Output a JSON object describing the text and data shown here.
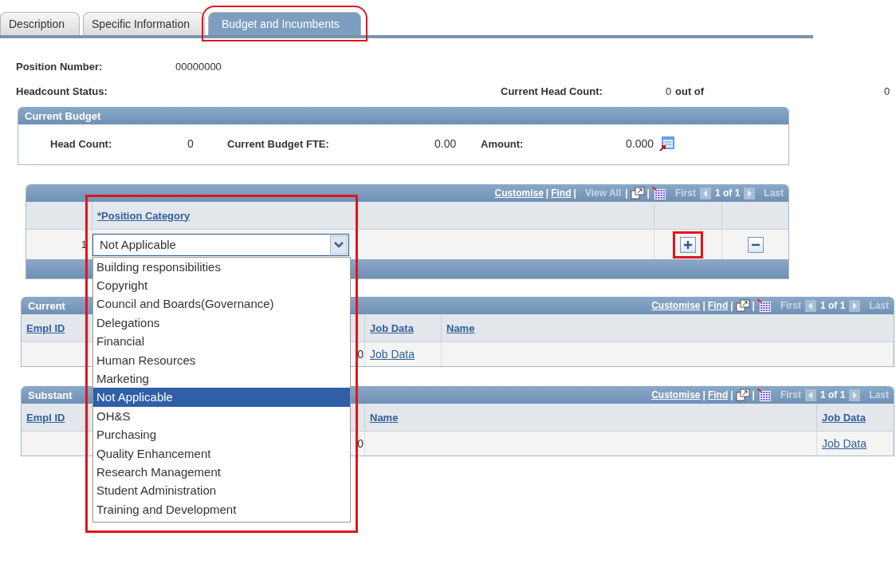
{
  "tabs": [
    {
      "label": "Description",
      "selected": false,
      "highlight": false
    },
    {
      "label": "Specific Information",
      "selected": false,
      "highlight": false
    },
    {
      "label": "Budget and Incumbents",
      "selected": true,
      "highlight": true
    }
  ],
  "position_number": {
    "label": "Position Number:",
    "value": "00000000"
  },
  "headcount": {
    "status_label": "Headcount Status:",
    "current_label": "Current Head Count:",
    "current_value": "0",
    "out_of": "out of",
    "total": "0"
  },
  "current_budget": {
    "title": "Current Budget",
    "fields": [
      {
        "label": "Head Count:",
        "value": "0"
      },
      {
        "label": "Current Budget FTE:",
        "value": "0.00"
      },
      {
        "label": "Amount:",
        "value": "0.000"
      }
    ]
  },
  "position_grid": {
    "nav": [
      {
        "kind": "link",
        "label": "Customise"
      },
      {
        "kind": "sep",
        "label": "|"
      },
      {
        "kind": "link",
        "label": "Find"
      },
      {
        "kind": "sep",
        "label": "|"
      },
      {
        "kind": "disabled",
        "label": "View All"
      },
      {
        "kind": "sep",
        "label": "|"
      },
      {
        "kind": "window-icon"
      },
      {
        "kind": "sep",
        "label": "|"
      },
      {
        "kind": "grid-icon"
      },
      {
        "kind": "disabled",
        "label": "First"
      },
      {
        "kind": "prev-icon"
      },
      {
        "kind": "count",
        "label": "1 of 1"
      },
      {
        "kind": "next-icon"
      },
      {
        "kind": "disabled",
        "label": "Last"
      }
    ],
    "column": "*Position Category",
    "highlight": true,
    "rows": [
      {
        "number": "1",
        "value": "Not Applicable",
        "expanded": true,
        "add_highlight": true,
        "options": [
          {
            "label": "Building responsibilities",
            "selected": false
          },
          {
            "label": "Copyright",
            "selected": false
          },
          {
            "label": "Council and Boards(Governance)",
            "selected": false
          },
          {
            "label": "Delegations",
            "selected": false
          },
          {
            "label": "Financial",
            "selected": false
          },
          {
            "label": "Human Resources",
            "selected": false
          },
          {
            "label": "Marketing",
            "selected": false
          },
          {
            "label": "Not Applicable",
            "selected": true
          },
          {
            "label": "OH&S",
            "selected": false
          },
          {
            "label": "Purchasing",
            "selected": false
          },
          {
            "label": "Quality Enhancement",
            "selected": false
          },
          {
            "label": "Research Management",
            "selected": false
          },
          {
            "label": "Student Administration",
            "selected": false
          },
          {
            "label": "Training and Development",
            "selected": false
          }
        ]
      }
    ]
  },
  "grids": [
    {
      "title": "Current",
      "nav": [
        {
          "kind": "link",
          "label": "Customise"
        },
        {
          "kind": "sep",
          "label": "|"
        },
        {
          "kind": "link",
          "label": "Find"
        },
        {
          "kind": "sep",
          "label": "|"
        },
        {
          "kind": "window-icon"
        },
        {
          "kind": "sep",
          "label": "|"
        },
        {
          "kind": "grid-icon"
        },
        {
          "kind": "disabled",
          "label": "First"
        },
        {
          "kind": "prev-icon"
        },
        {
          "kind": "count",
          "label": "1 of 1"
        },
        {
          "kind": "next-icon"
        },
        {
          "kind": "disabled",
          "label": "Last"
        }
      ],
      "columns": [
        {
          "label": "Empl ID",
          "kind": "text"
        },
        {
          "label": "Job Data",
          "kind": "link"
        },
        {
          "label": "Name",
          "kind": "text"
        }
      ],
      "rows": [
        {
          "hidden_value": "0",
          "link": "Job Data"
        }
      ]
    },
    {
      "title": "Substant",
      "nav": [
        {
          "kind": "link",
          "label": "Customise"
        },
        {
          "kind": "sep",
          "label": "|"
        },
        {
          "kind": "link",
          "label": "Find"
        },
        {
          "kind": "sep",
          "label": "|"
        },
        {
          "kind": "window-icon"
        },
        {
          "kind": "sep",
          "label": "|"
        },
        {
          "kind": "grid-icon"
        },
        {
          "kind": "disabled",
          "label": "First"
        },
        {
          "kind": "prev-icon"
        },
        {
          "kind": "count",
          "label": "1 of 1"
        },
        {
          "kind": "next-icon"
        },
        {
          "kind": "disabled",
          "label": "Last"
        }
      ],
      "columns": [
        {
          "label": "Empl ID",
          "kind": "text"
        },
        {
          "label": "Name",
          "kind": "text"
        },
        {
          "label": "Job Data",
          "kind": "link"
        }
      ],
      "rows": [
        {
          "hidden_value": "0",
          "link": "Job Data"
        }
      ]
    }
  ]
}
